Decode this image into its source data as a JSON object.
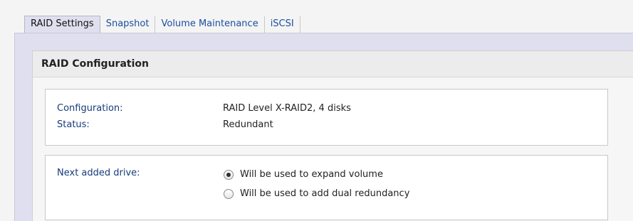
{
  "tabs": [
    {
      "label": "RAID Settings",
      "active": true
    },
    {
      "label": "Snapshot",
      "active": false
    },
    {
      "label": "Volume Maintenance",
      "active": false
    },
    {
      "label": "iSCSI",
      "active": false
    }
  ],
  "section": {
    "title": "RAID Configuration"
  },
  "config": {
    "configuration_label": "Configuration:",
    "configuration_value": "RAID Level X-RAID2, 4 disks",
    "status_label": "Status:",
    "status_value": "Redundant"
  },
  "next_drive": {
    "label": "Next added drive:",
    "options": [
      {
        "label": "Will be used to expand volume",
        "selected": true
      },
      {
        "label": "Will be used to add dual redundancy",
        "selected": false
      }
    ]
  }
}
